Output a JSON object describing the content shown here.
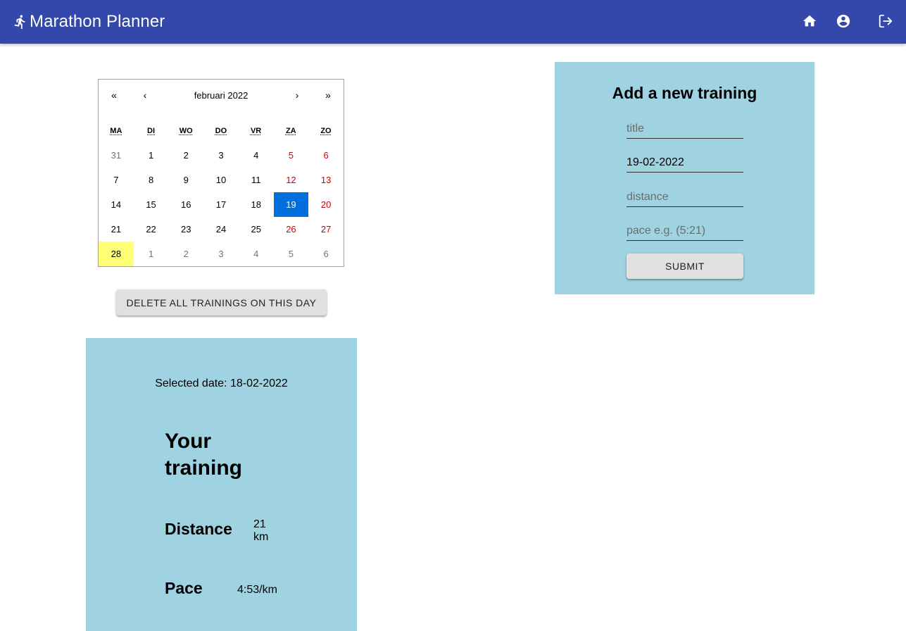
{
  "app": {
    "title": "Marathon Planner",
    "colors": {
      "appbar": "#3447ab",
      "panel": "#9fd3e1",
      "selected_day": "#006edc",
      "today": "#ffff76",
      "weekend": "#d10000"
    },
    "icons": [
      "running-icon",
      "home-icon",
      "account-icon",
      "logout-icon"
    ]
  },
  "calendar": {
    "nav": {
      "prev_year": "«",
      "prev_month": "‹",
      "next_month": "›",
      "next_year": "»"
    },
    "month_label": "februari 2022",
    "weekdays": [
      "MA",
      "DI",
      "WO",
      "DO",
      "VR",
      "ZA",
      "ZO"
    ],
    "days": [
      {
        "label": "31",
        "neighbor": true,
        "weekend": false
      },
      {
        "label": "1",
        "neighbor": false,
        "weekend": false
      },
      {
        "label": "2",
        "neighbor": false,
        "weekend": false
      },
      {
        "label": "3",
        "neighbor": false,
        "weekend": false
      },
      {
        "label": "4",
        "neighbor": false,
        "weekend": false
      },
      {
        "label": "5",
        "neighbor": false,
        "weekend": true
      },
      {
        "label": "6",
        "neighbor": false,
        "weekend": true
      },
      {
        "label": "7",
        "neighbor": false,
        "weekend": false
      },
      {
        "label": "8",
        "neighbor": false,
        "weekend": false
      },
      {
        "label": "9",
        "neighbor": false,
        "weekend": false
      },
      {
        "label": "10",
        "neighbor": false,
        "weekend": false
      },
      {
        "label": "11",
        "neighbor": false,
        "weekend": false
      },
      {
        "label": "12",
        "neighbor": false,
        "weekend": true
      },
      {
        "label": "13",
        "neighbor": false,
        "weekend": true
      },
      {
        "label": "14",
        "neighbor": false,
        "weekend": false
      },
      {
        "label": "15",
        "neighbor": false,
        "weekend": false
      },
      {
        "label": "16",
        "neighbor": false,
        "weekend": false
      },
      {
        "label": "17",
        "neighbor": false,
        "weekend": false
      },
      {
        "label": "18",
        "neighbor": false,
        "weekend": false
      },
      {
        "label": "19",
        "neighbor": false,
        "weekend": true,
        "active": true
      },
      {
        "label": "20",
        "neighbor": false,
        "weekend": true
      },
      {
        "label": "21",
        "neighbor": false,
        "weekend": false
      },
      {
        "label": "22",
        "neighbor": false,
        "weekend": false
      },
      {
        "label": "23",
        "neighbor": false,
        "weekend": false
      },
      {
        "label": "24",
        "neighbor": false,
        "weekend": false
      },
      {
        "label": "25",
        "neighbor": false,
        "weekend": false
      },
      {
        "label": "26",
        "neighbor": false,
        "weekend": true
      },
      {
        "label": "27",
        "neighbor": false,
        "weekend": true
      },
      {
        "label": "28",
        "neighbor": false,
        "weekend": false,
        "today": true
      },
      {
        "label": "1",
        "neighbor": true,
        "weekend": false
      },
      {
        "label": "2",
        "neighbor": true,
        "weekend": false
      },
      {
        "label": "3",
        "neighbor": true,
        "weekend": false
      },
      {
        "label": "4",
        "neighbor": true,
        "weekend": false
      },
      {
        "label": "5",
        "neighbor": true,
        "weekend": true
      },
      {
        "label": "6",
        "neighbor": true,
        "weekend": true
      }
    ]
  },
  "delete_button": {
    "label": "DELETE ALL TRAININGS ON THIS DAY"
  },
  "training": {
    "selected_date": "Selected date: 18-02-2022",
    "heading": "Your training",
    "distance_label": "Distance",
    "distance_value": "21 km",
    "pace_label": "Pace",
    "pace_value": "4:53/km"
  },
  "form": {
    "title": "Add a new training",
    "title_placeholder": "title",
    "date_value": "19-02-2022",
    "distance_placeholder": "distance",
    "pace_placeholder": "pace e.g. (5:21)",
    "submit_label": "SUBMIT"
  }
}
